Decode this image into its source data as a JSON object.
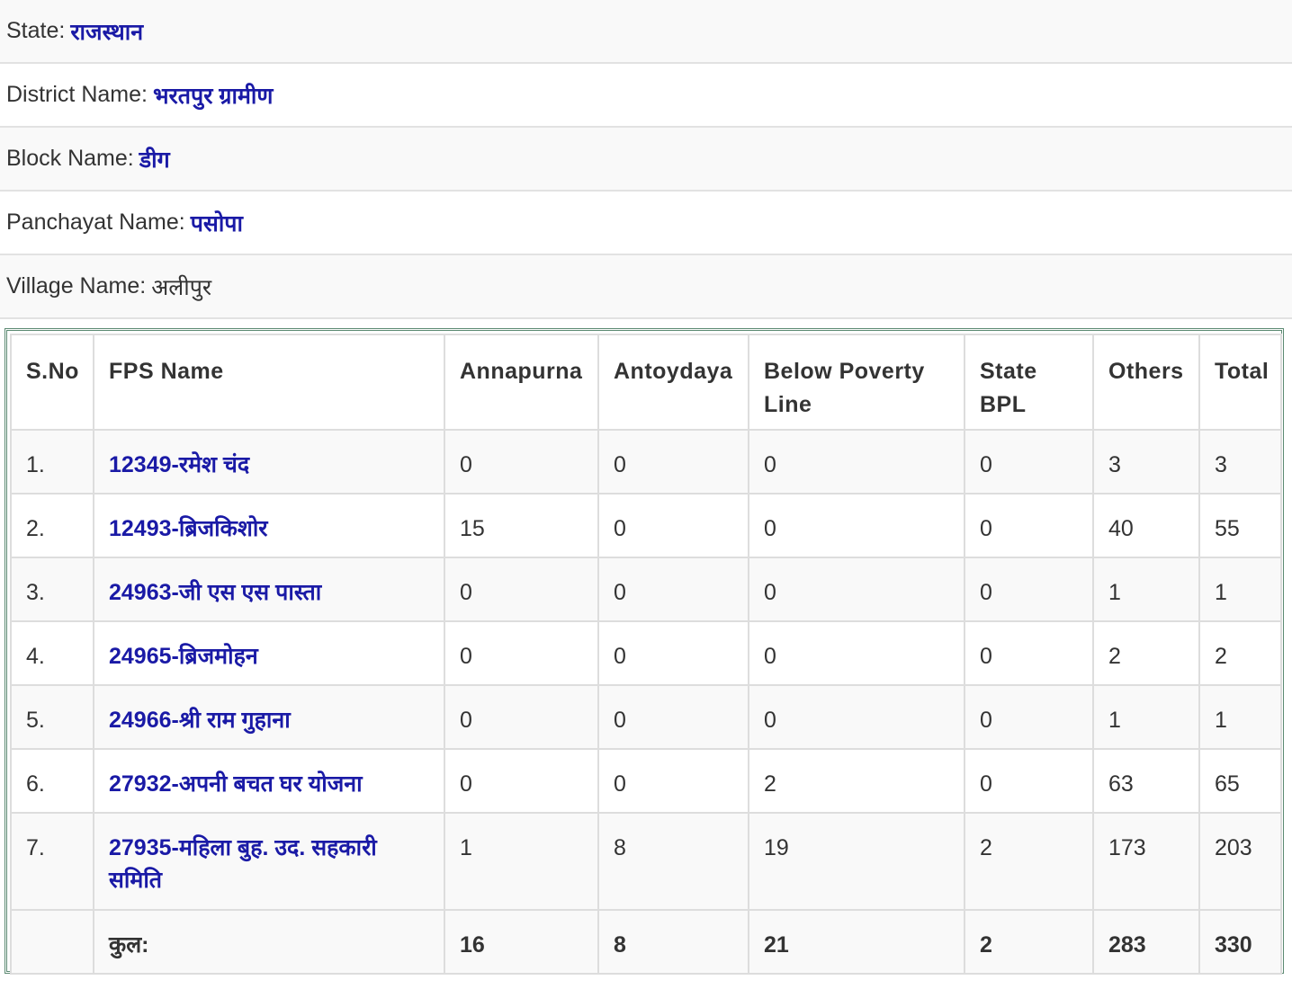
{
  "info": {
    "state": {
      "label": "State:",
      "value": "राजस्थान"
    },
    "district": {
      "label": "District Name:",
      "value": "भरतपुर  ग्रामीण"
    },
    "block": {
      "label": "Block Name:",
      "value": "डीग"
    },
    "panchayat": {
      "label": "Panchayat Name:",
      "value": "पसोपा"
    },
    "village": {
      "label": "Village Name:",
      "value": "अलीपुर"
    }
  },
  "table": {
    "headers": [
      "S.No",
      "FPS Name",
      "Annapurna",
      "Antoydaya",
      "Below Poverty Line",
      "State BPL",
      "Others",
      "Total"
    ],
    "rows": [
      {
        "sno": "1.",
        "fps": "12349-रमेश चंद",
        "annapurna": "0",
        "antoydaya": "0",
        "bpl": "0",
        "state_bpl": "0",
        "others": "3",
        "total": "3"
      },
      {
        "sno": "2.",
        "fps": "12493-ब्रिजकिशोर",
        "annapurna": "15",
        "antoydaya": "0",
        "bpl": "0",
        "state_bpl": "0",
        "others": "40",
        "total": "55"
      },
      {
        "sno": "3.",
        "fps": "24963-जी एस एस पास्ता",
        "annapurna": "0",
        "antoydaya": "0",
        "bpl": "0",
        "state_bpl": "0",
        "others": "1",
        "total": "1"
      },
      {
        "sno": "4.",
        "fps": "24965-ब्रिजमोहन",
        "annapurna": "0",
        "antoydaya": "0",
        "bpl": "0",
        "state_bpl": "0",
        "others": "2",
        "total": "2"
      },
      {
        "sno": "5.",
        "fps": "24966-श्री राम गुहाना",
        "annapurna": "0",
        "antoydaya": "0",
        "bpl": "0",
        "state_bpl": "0",
        "others": "1",
        "total": "1"
      },
      {
        "sno": "6.",
        "fps": "27932-अपनी बचत घर योजना",
        "annapurna": "0",
        "antoydaya": "0",
        "bpl": "2",
        "state_bpl": "0",
        "others": "63",
        "total": "65"
      },
      {
        "sno": "7.",
        "fps": "27935-महिला बुह. उद. सहकारी समिति",
        "annapurna": "1",
        "antoydaya": "8",
        "bpl": "19",
        "state_bpl": "2",
        "others": "173",
        "total": "203"
      }
    ],
    "totals": {
      "label": "कुल:",
      "annapurna": "16",
      "antoydaya": "8",
      "bpl": "21",
      "state_bpl": "2",
      "others": "283",
      "total": "330"
    }
  }
}
